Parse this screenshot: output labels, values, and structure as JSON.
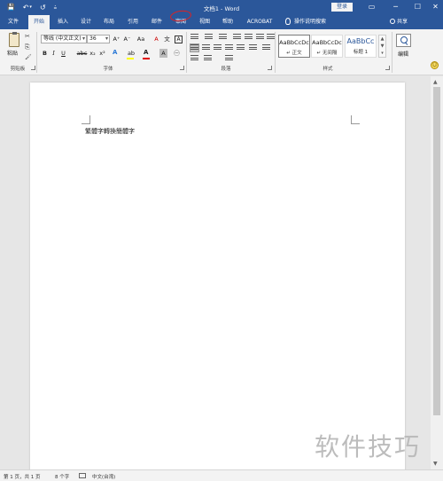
{
  "titlebar": {
    "title": "文档1 - Word",
    "login_label": "登录",
    "qat": {
      "save": "💾",
      "undo": "↶",
      "undo_dd": "▾",
      "redo": "↺",
      "customize": "⩮"
    },
    "controls": {
      "restore_ribbon": "▭",
      "minimize": "─",
      "maximize": "☐",
      "close": "✕"
    }
  },
  "tabs": {
    "items": [
      "文件",
      "开始",
      "插入",
      "设计",
      "布局",
      "引用",
      "邮件",
      "审阅",
      "视图",
      "帮助",
      "ACROBAT"
    ],
    "active": "开始",
    "tell_me": "操作说明搜索",
    "share": "共享"
  },
  "ribbon": {
    "clipboard": {
      "label": "剪贴板",
      "paste": "粘贴",
      "cut_icon": "✂",
      "copy_icon": "⎘",
      "painter_icon": "🖌"
    },
    "font": {
      "label": "字体",
      "font_name": "等线 (中文正文)",
      "font_size": "36",
      "grow": "A⁺",
      "shrink": "A⁻",
      "change_case": "Aa",
      "clear_format": "A",
      "phonetic": "文",
      "border_char": "A",
      "bold": "B",
      "italic": "I",
      "underline": "U",
      "strike": "abc",
      "subscript": "x₂",
      "superscript": "x²",
      "text_effects": "A",
      "highlight": "ab",
      "font_color": "A",
      "char_shading": "A",
      "enclose": "㊀"
    },
    "paragraph": {
      "label": "段落"
    },
    "styles": {
      "label": "样式",
      "items": [
        {
          "sample": "AaBbCcDc",
          "name": "↵ 正文"
        },
        {
          "sample": "AaBbCcDc",
          "name": "↵ 无间隔"
        },
        {
          "sample": "AaBbCc",
          "name": "标题 1"
        }
      ],
      "scroll_up": "▲",
      "scroll_down": "▼",
      "more": "▾"
    },
    "editing": {
      "label": "编辑"
    },
    "smiley": "☺"
  },
  "document": {
    "text": "繁體字轉換簡體字"
  },
  "statusbar": {
    "page": "第 1 页，共 1 页",
    "words": "8 个字",
    "language": "中文(台湾)"
  },
  "watermark": "软件技巧",
  "colors": {
    "accent": "#2b579a",
    "highlight_yellow": "#ffff00",
    "font_red": "#e00000",
    "annotation_red": "#dd2222"
  }
}
